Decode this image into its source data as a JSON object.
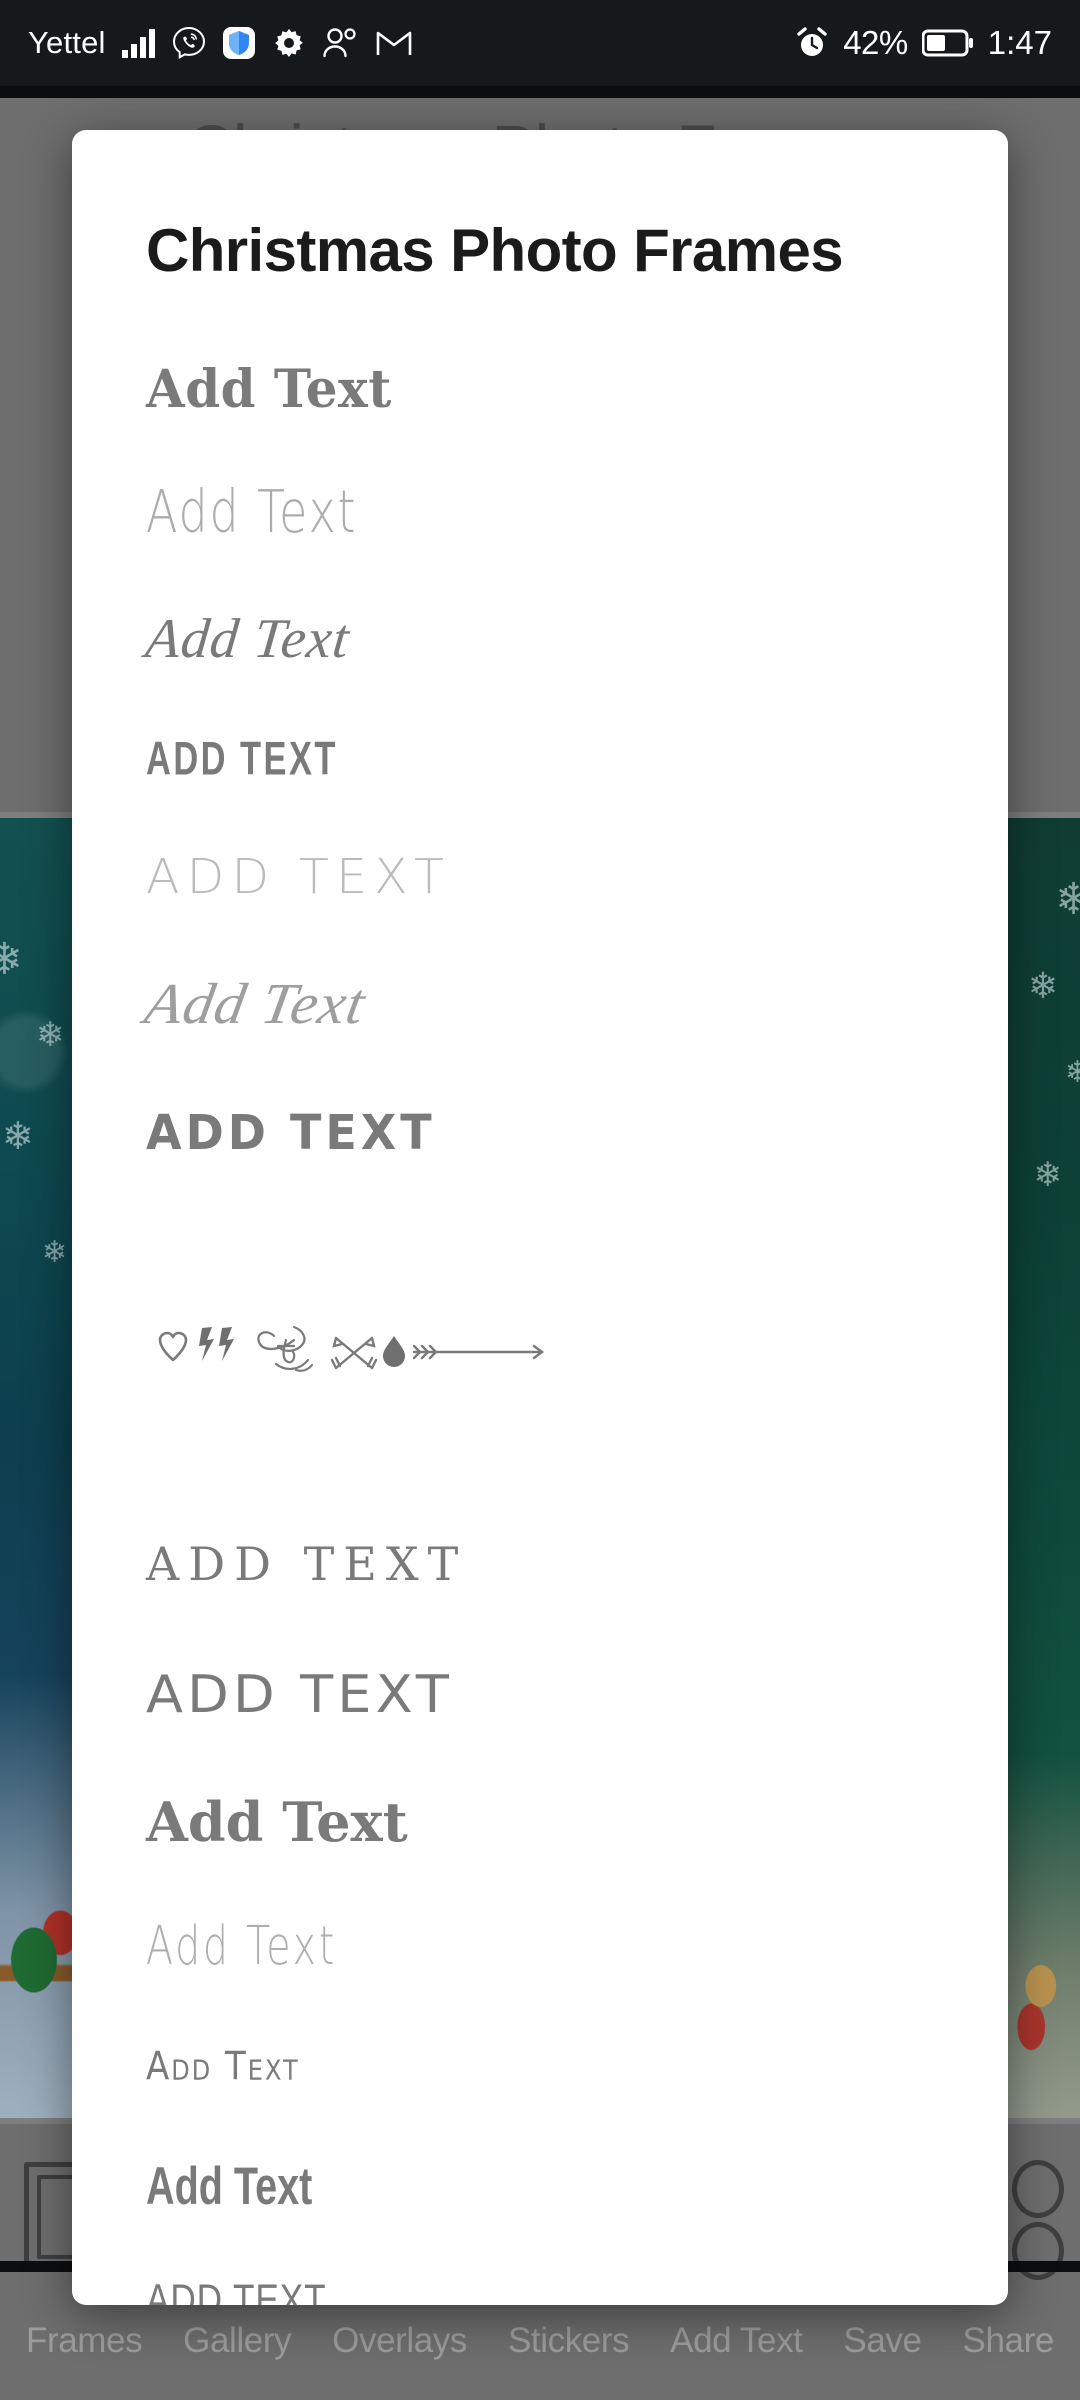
{
  "status_bar": {
    "carrier": "Yettel",
    "battery_percent": "42%",
    "clock": "1:47",
    "icons": [
      "signal-bars-icon",
      "viber-icon",
      "shield-icon",
      "gear-icon",
      "contacts-icon",
      "gmail-icon",
      "alarm-icon",
      "battery-icon"
    ]
  },
  "background_app": {
    "title": "Christmas Photo Frames",
    "icons": [
      "frame-icon",
      "glasses-icon"
    ]
  },
  "dialog": {
    "title": "Christmas Photo Frames",
    "font_options": [
      {
        "label": "Add Text",
        "style": "s-blackletter",
        "name": "font-option-blackletter"
      },
      {
        "label": "Add Text",
        "style": "s-thinhand",
        "name": "font-option-thin-handwriting"
      },
      {
        "label": "Add Text",
        "style": "s-script",
        "name": "font-option-elegant-script"
      },
      {
        "label": "ADD TEXT",
        "style": "s-condbold",
        "name": "font-option-condensed-bold-caps"
      },
      {
        "label": "ADD TEXT",
        "style": "s-geoline",
        "name": "font-option-geometric-outline"
      },
      {
        "label": "Add Text",
        "style": "s-flourish",
        "name": "font-option-flourished-script"
      },
      {
        "label": "ADD TEXT",
        "style": "s-rounded",
        "name": "font-option-rounded-bold"
      },
      {
        "label": "",
        "style": "s-dingbat",
        "name": "font-option-dingbat-symbols"
      },
      {
        "label": "ADD TEXT",
        "style": "s-slabcaps",
        "name": "font-option-typewriter-caps"
      },
      {
        "label": "ADD TEXT",
        "style": "s-geosans",
        "name": "font-option-geometric-sans-caps"
      },
      {
        "label": "Add Text",
        "style": "s-fatslab",
        "name": "font-option-fat-slab-serif"
      },
      {
        "label": "Add Text",
        "style": "s-thincond",
        "name": "font-option-thin-condensed"
      },
      {
        "label": "Add Text",
        "style": "s-smallcaps",
        "name": "font-option-small-caps-hand"
      },
      {
        "label": "Add Text",
        "style": "s-boldcond",
        "name": "font-option-bold-condensed-sans"
      },
      {
        "label": "ADD TEXT",
        "style": "s-thincaps",
        "name": "font-option-thin-caps-sans"
      }
    ],
    "dingbat_glyphs": [
      "heart-icon",
      "double-lightning-icon",
      "of-flourish-icon",
      "crossed-arrows-icon",
      "teardrop-icon",
      "long-arrow-icon"
    ]
  },
  "bottom_nav": {
    "items": [
      {
        "label": "Frames",
        "name": "nav-frames"
      },
      {
        "label": "Gallery",
        "name": "nav-gallery"
      },
      {
        "label": "Overlays",
        "name": "nav-overlays"
      },
      {
        "label": "Stickers",
        "name": "nav-stickers"
      },
      {
        "label": "Add Text",
        "name": "nav-add-text"
      },
      {
        "label": "Save",
        "name": "nav-save"
      },
      {
        "label": "Share",
        "name": "nav-share"
      }
    ]
  },
  "colors": {
    "dialog_bg": "#ffffff",
    "scrim": "#6e6e6e",
    "status_bar_bg": "#16191c",
    "font_preview_text": "#7a7a7a",
    "title_text": "#1b1b1b",
    "nav_text": "#9c9c9c"
  }
}
